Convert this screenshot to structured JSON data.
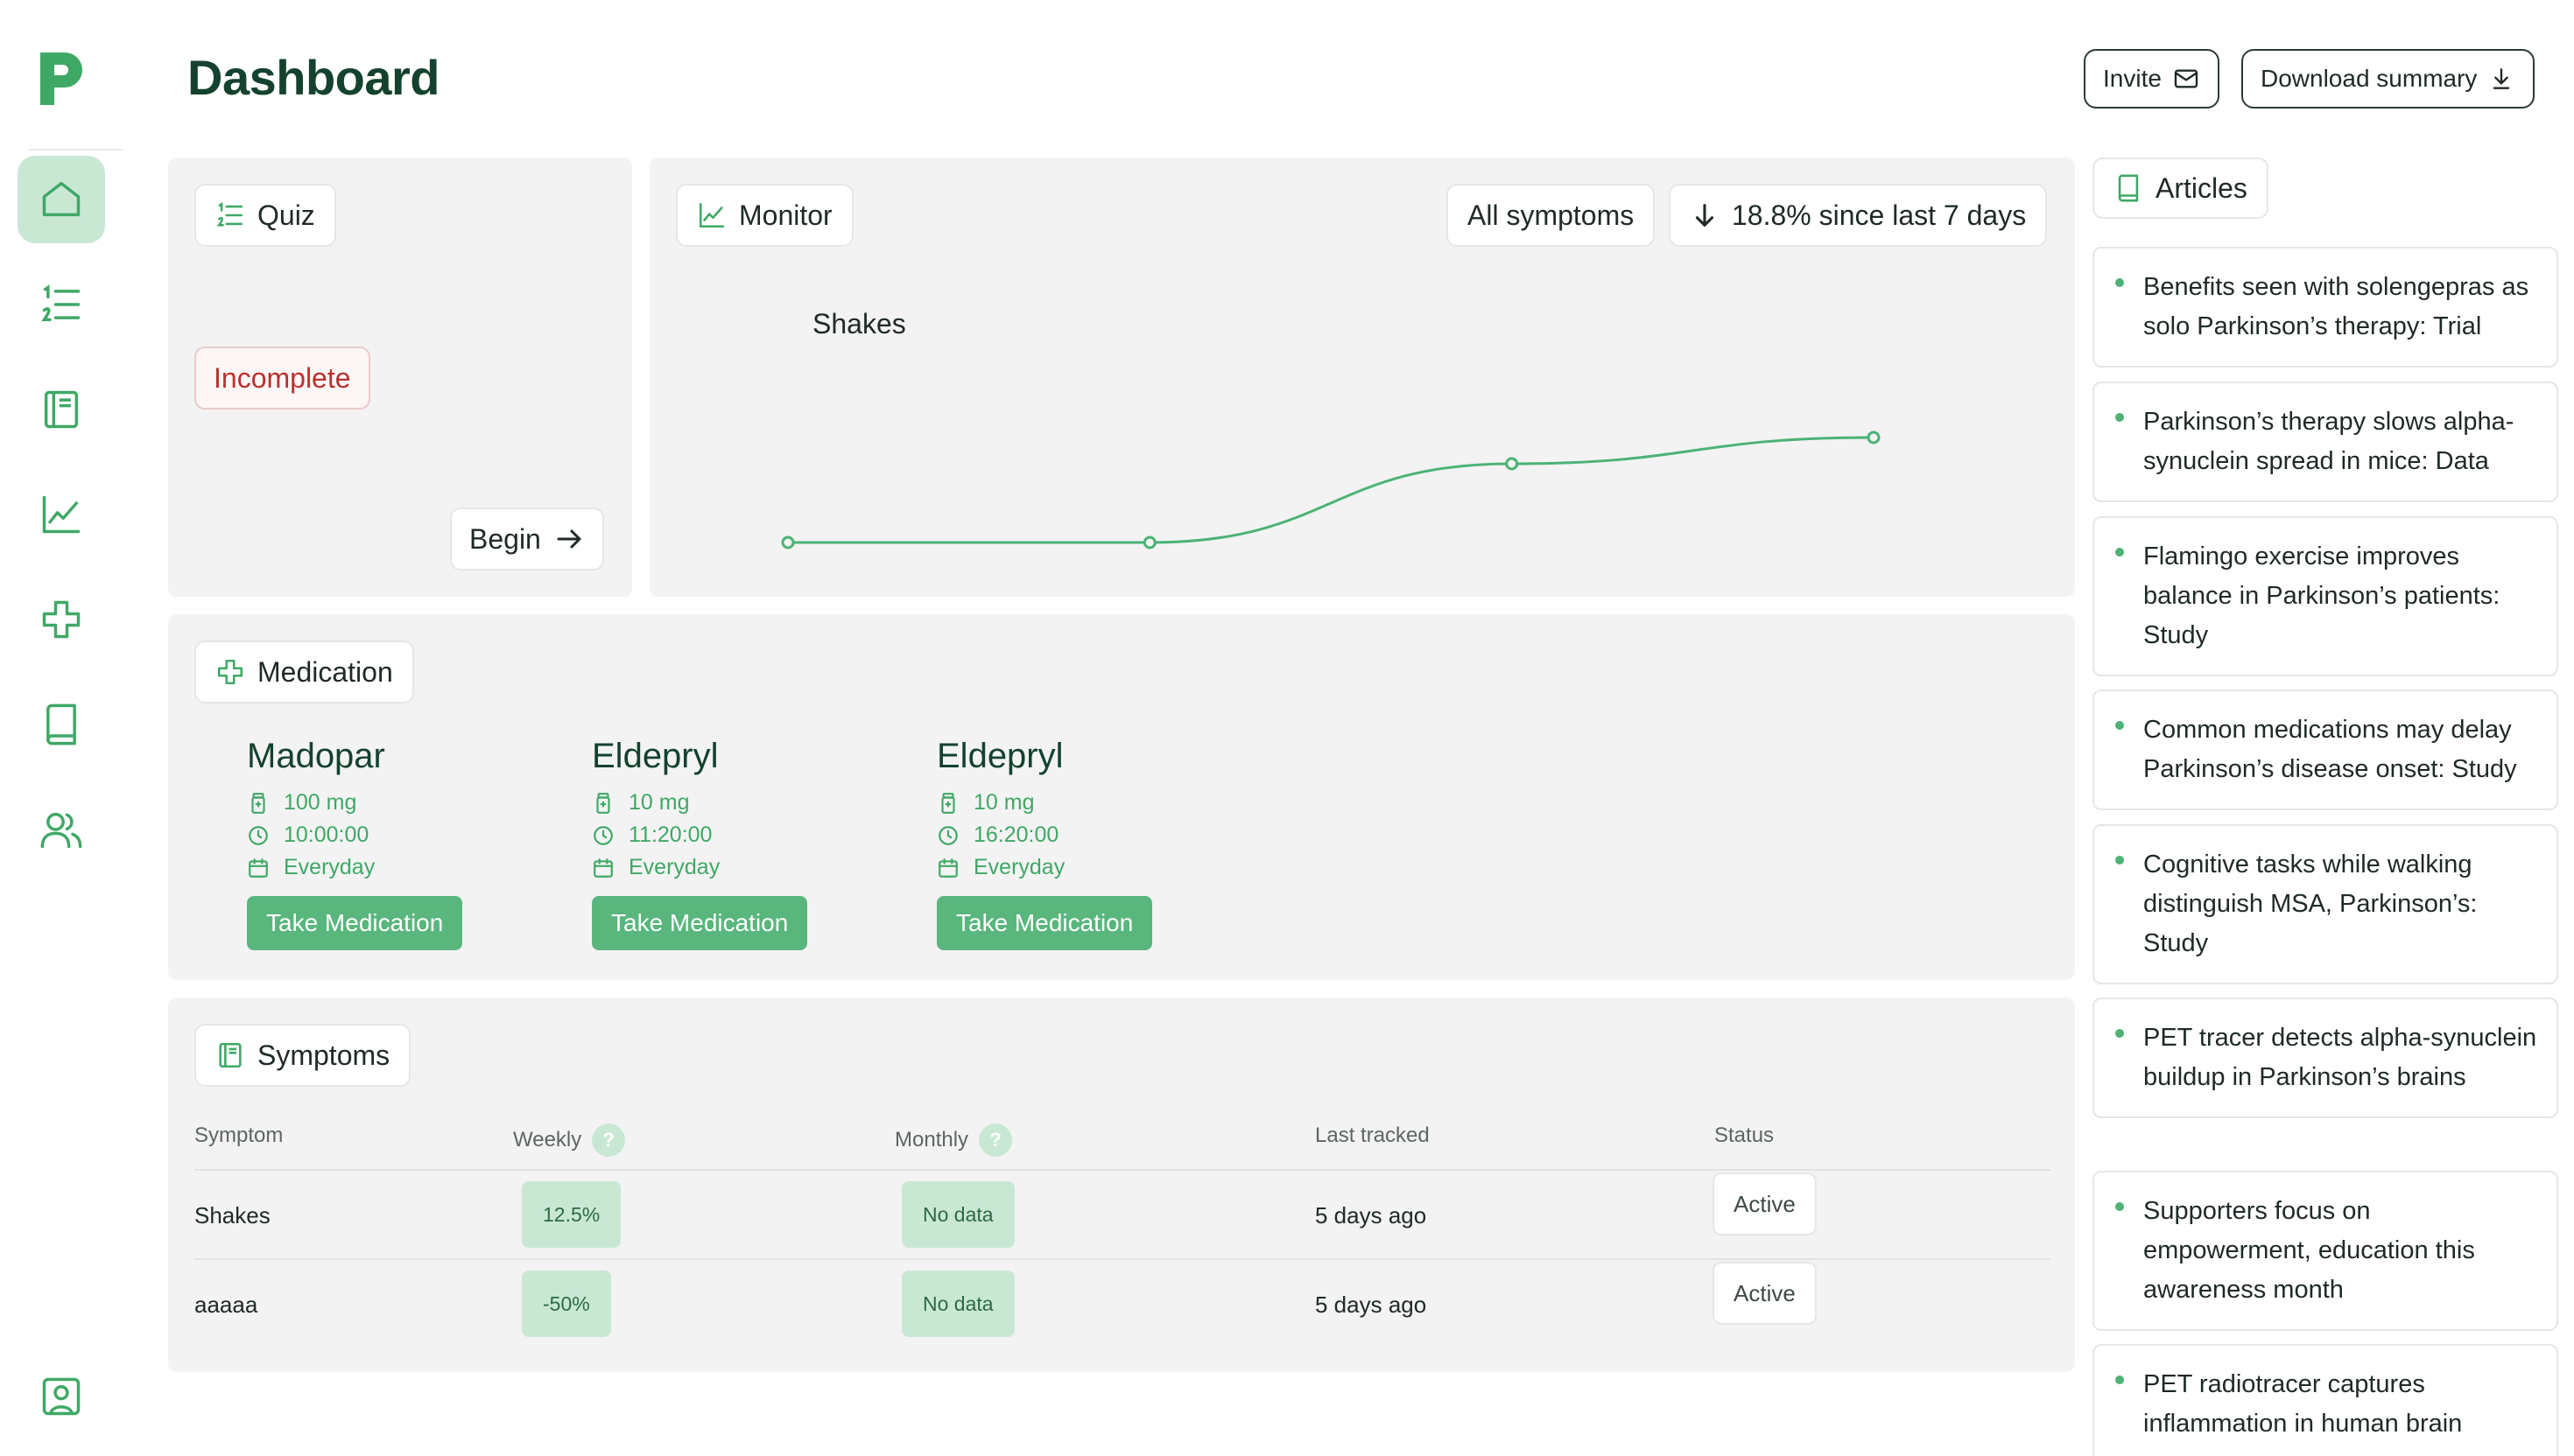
{
  "header": {
    "title": "Dashboard",
    "invite_label": "Invite",
    "download_label": "Download summary"
  },
  "sidebar": {
    "logo": "P",
    "items": [
      {
        "icon": "home-icon",
        "active": true
      },
      {
        "icon": "numbered-list-icon",
        "active": false
      },
      {
        "icon": "notebook-icon",
        "active": false
      },
      {
        "icon": "chart-line-icon",
        "active": false
      },
      {
        "icon": "medical-cross-icon",
        "active": false
      },
      {
        "icon": "book-icon",
        "active": false
      },
      {
        "icon": "users-icon",
        "active": false
      }
    ],
    "bottom_icon": "profile-badge-icon"
  },
  "quiz": {
    "title": "Quiz",
    "status": "Incomplete",
    "begin_label": "Begin"
  },
  "monitor": {
    "title": "Monitor",
    "filter_label": "All symptoms",
    "change_label": "18.8% since last 7 days"
  },
  "chart_data": {
    "type": "line",
    "title": "Shakes",
    "series": [
      {
        "values": [
          0,
          0,
          0.75,
          1
        ]
      }
    ],
    "grid": false,
    "color": "#4cb374"
  },
  "medication": {
    "title": "Medication",
    "items": [
      {
        "name": "Madopar",
        "dose": "100 mg",
        "time": "10:00:00",
        "frequency": "Everyday",
        "button": "Take Medication"
      },
      {
        "name": "Eldepryl",
        "dose": "10 mg",
        "time": "11:20:00",
        "frequency": "Everyday",
        "button": "Take Medication"
      },
      {
        "name": "Eldepryl",
        "dose": "10 mg",
        "time": "16:20:00",
        "frequency": "Everyday",
        "button": "Take Medication"
      }
    ]
  },
  "symptoms": {
    "title": "Symptoms",
    "columns": {
      "symptom": "Symptom",
      "weekly": "Weekly",
      "monthly": "Monthly",
      "last_tracked": "Last tracked",
      "status": "Status"
    },
    "help_glyph": "?",
    "rows": [
      {
        "symptom": "Shakes",
        "weekly": "12.5%",
        "monthly": "No data",
        "last_tracked": "5 days ago",
        "status": "Active"
      },
      {
        "symptom": "aaaaa",
        "weekly": "-50%",
        "monthly": "No data",
        "last_tracked": "5 days ago",
        "status": "Active"
      }
    ]
  },
  "articles": {
    "title": "Articles",
    "items": [
      "Benefits seen with solengepras as solo Parkinson’s therapy: Trial",
      "Parkinson’s therapy slows alpha-synuclein spread in mice: Data",
      "Flamingo exercise improves balance in Parkinson’s patients: Study",
      "Common medications may delay Parkinson’s disease onset: Study",
      "Cognitive tasks while walking distinguish MSA, Parkinson’s: Study",
      "PET tracer detects alpha-synuclein buildup in Parkinson’s brains",
      "Supporters focus on empowerment, education this awareness month",
      "PET radiotracer captures inflammation in human brain"
    ]
  },
  "colors": {
    "accent": "#4cb374",
    "accent_light": "#c9e8d4",
    "title_green": "#14422e",
    "danger": "#b8322d"
  }
}
